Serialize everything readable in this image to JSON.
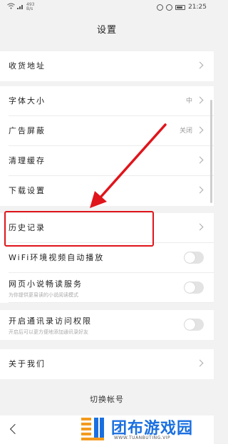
{
  "status_bar": {
    "net_speed": "493",
    "net_unit": "B/s",
    "time": "21:25"
  },
  "header": {
    "title": "设置"
  },
  "settings": {
    "address": {
      "label": "收货地址"
    },
    "font_size": {
      "label": "字体大小",
      "value": "中"
    },
    "ad_block": {
      "label": "广告屏蔽",
      "value": "关闭"
    },
    "clear_cache": {
      "label": "清理缓存"
    },
    "download": {
      "label": "下载设置"
    },
    "history": {
      "label": "历史记录"
    },
    "wifi_autoplay": {
      "label": "WiFi环境视频自动播放",
      "enabled": false
    },
    "novel_service": {
      "label": "网页小说畅读服务",
      "sublabel": "为你提供更易读的小说阅读模式",
      "enabled": false
    },
    "contacts_access": {
      "label": "开启通讯录访问权限",
      "sublabel": "开启后可以更方便地添加通讯录好友",
      "enabled": false
    },
    "about": {
      "label": "关于我们"
    }
  },
  "footer": {
    "switch_account": "切换帐号"
  },
  "watermark": {
    "text": "团布游戏园",
    "url": "WWW.TUANBUTING.VIP"
  },
  "colors": {
    "annotation": "#e0151b",
    "watermark_blue": "#1a6fe0",
    "watermark_orange": "#f39a1e"
  }
}
